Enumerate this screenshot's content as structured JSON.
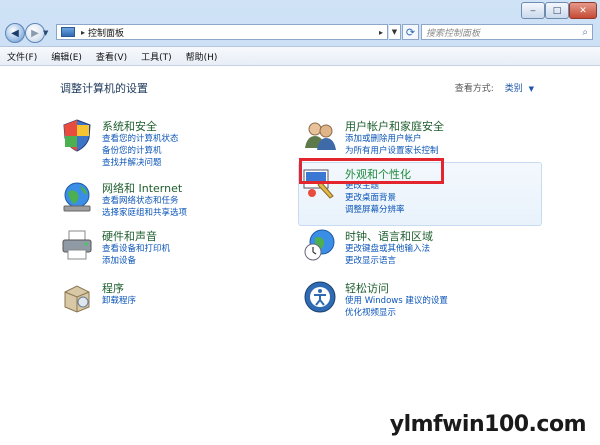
{
  "titlebar": {
    "minimize": "‒",
    "maximize": "□",
    "close": "✕"
  },
  "nav": {
    "address_crumb": "控制面板",
    "search_placeholder": "搜索控制面板"
  },
  "menu": [
    "文件(F)",
    "编辑(E)",
    "查看(V)",
    "工具(T)",
    "帮助(H)"
  ],
  "page": {
    "title": "调整计算机的设置",
    "view_by_label": "查看方式:",
    "view_by_value": "类别"
  },
  "categories": [
    {
      "title": "系统和安全",
      "links": [
        "查看您的计算机状态",
        "备份您的计算机",
        "查找并解决问题"
      ]
    },
    {
      "title": "网络和 Internet",
      "links": [
        "查看网络状态和任务",
        "选择家庭组和共享选项"
      ]
    },
    {
      "title": "硬件和声音",
      "links": [
        "查看设备和打印机",
        "添加设备"
      ]
    },
    {
      "title": "程序",
      "links": [
        "卸载程序"
      ]
    },
    {
      "title": "用户帐户和家庭安全",
      "links": [
        "添加或删除用户帐户",
        "为所有用户设置家长控制"
      ]
    },
    {
      "title": "外观和个性化",
      "links": [
        "更改主题",
        "更改桌面背景",
        "调整屏幕分辨率"
      ]
    },
    {
      "title": "时钟、语言和区域",
      "links": [
        "更改键盘或其他输入法",
        "更改显示语言"
      ]
    },
    {
      "title": "轻松访问",
      "links": [
        "使用 Windows 建议的设置",
        "优化视频显示"
      ]
    }
  ],
  "watermark": "ylmfwin100.com",
  "colors": {
    "highlight_box": "#e3262e",
    "link": "#0c56b8",
    "category_title": "#1e5e2e"
  }
}
